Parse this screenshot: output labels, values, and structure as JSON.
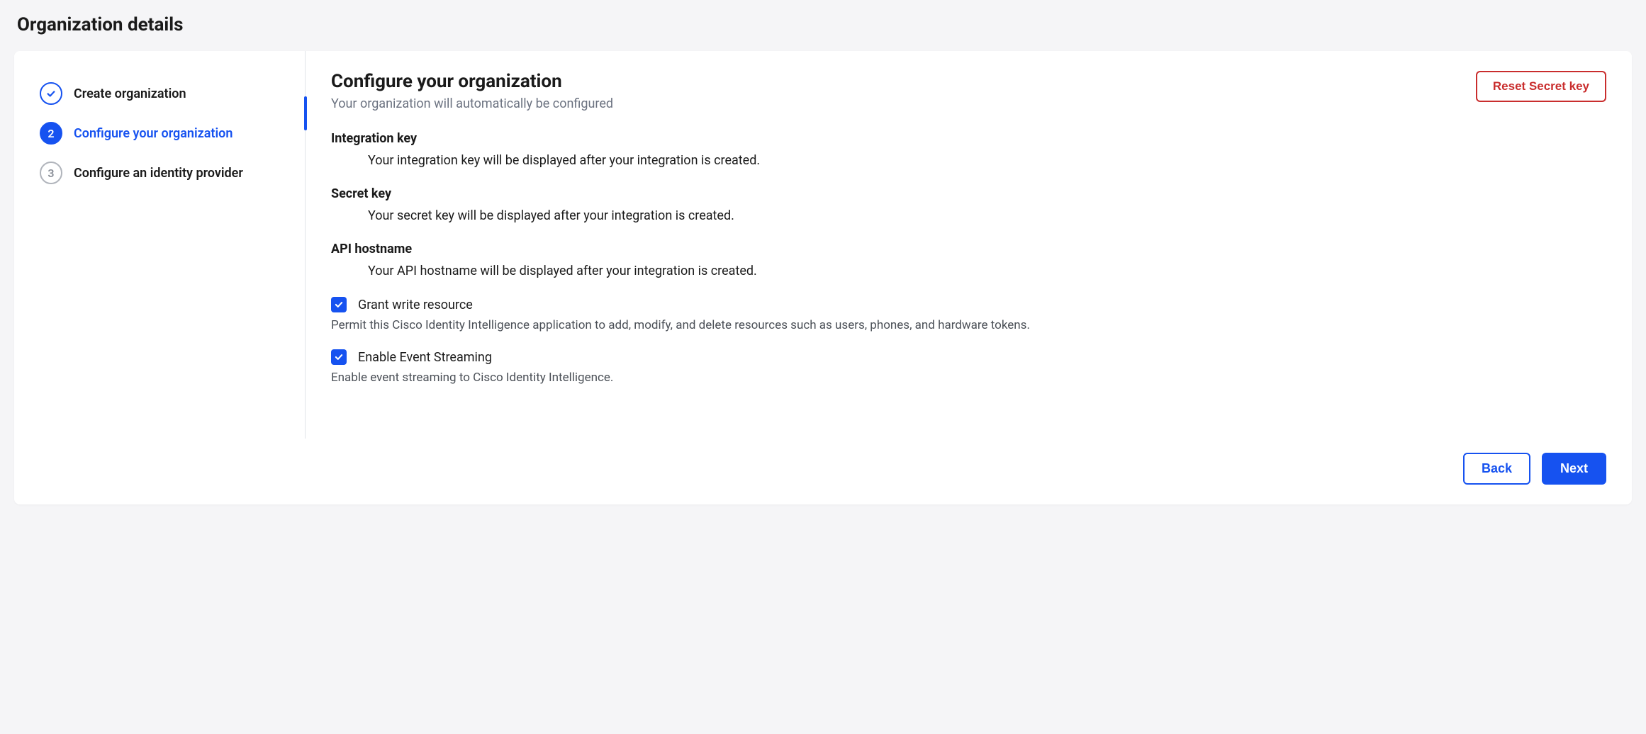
{
  "page": {
    "title": "Organization details"
  },
  "sidebar": {
    "steps": [
      {
        "number": "✓",
        "label": "Create organization",
        "state": "done"
      },
      {
        "number": "2",
        "label": "Configure your organization",
        "state": "active"
      },
      {
        "number": "3",
        "label": "Configure an identity provider",
        "state": "pending"
      }
    ]
  },
  "main": {
    "title": "Configure your organization",
    "subtitle": "Your organization will automatically be configured",
    "reset_button": "Reset Secret key",
    "fields": [
      {
        "label": "Integration key",
        "value": "Your integration key will be displayed after your integration is created."
      },
      {
        "label": "Secret key",
        "value": "Your secret key will be displayed after your integration is created."
      },
      {
        "label": "API hostname",
        "value": "Your API hostname will be displayed after your integration is created."
      }
    ],
    "checkboxes": [
      {
        "label": "Grant write resource",
        "description": "Permit this Cisco Identity Intelligence application to add, modify, and delete resources such as users, phones, and hardware tokens.",
        "checked": true
      },
      {
        "label": "Enable Event Streaming",
        "description": "Enable event streaming to Cisco Identity Intelligence.",
        "checked": true
      }
    ]
  },
  "footer": {
    "back": "Back",
    "next": "Next"
  }
}
